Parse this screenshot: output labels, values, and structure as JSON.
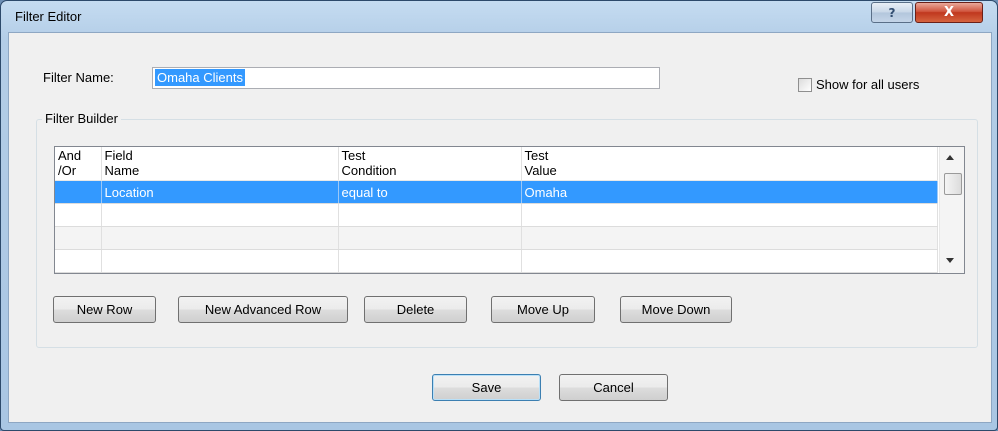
{
  "window": {
    "title": "Filter Editor"
  },
  "titlebar": {
    "help_label": "?",
    "close_label": "X"
  },
  "form": {
    "filter_name_label": "Filter Name:",
    "filter_name_value": "Omaha Clients",
    "show_all_label": "Show for all users",
    "show_all_checked": false,
    "filter_builder_label": "Filter Builder"
  },
  "grid": {
    "columns": [
      {
        "line1": "And",
        "line2": "/Or"
      },
      {
        "line1": "Field",
        "line2": "Name"
      },
      {
        "line1": "Test",
        "line2": "Condition"
      },
      {
        "line1": "Test",
        "line2": "Value"
      }
    ],
    "rows": [
      {
        "and_or": "",
        "field": "Location",
        "condition": "equal to",
        "value": "Omaha",
        "selected": true
      },
      {
        "and_or": "",
        "field": "",
        "condition": "",
        "value": ""
      },
      {
        "and_or": "",
        "field": "",
        "condition": "",
        "value": ""
      },
      {
        "and_or": "",
        "field": "",
        "condition": "",
        "value": ""
      }
    ]
  },
  "buttons": {
    "new_row": "New Row",
    "new_advanced_row": "New Advanced Row",
    "delete": "Delete",
    "move_up": "Move Up",
    "move_down": "Move Down",
    "save": "Save",
    "cancel": "Cancel"
  },
  "colors": {
    "selection": "#3399ff",
    "title_gradient": "#b3cde7",
    "close_button": "#c0371e"
  }
}
